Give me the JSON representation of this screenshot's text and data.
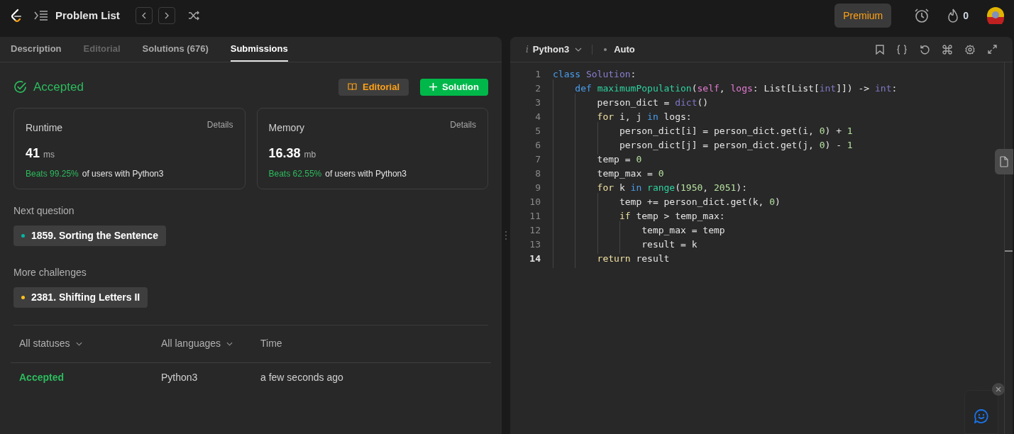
{
  "topbar": {
    "title": "Problem List",
    "premium": "Premium",
    "streak": "0"
  },
  "left_tabs": [
    {
      "label": "Description",
      "selected": false,
      "disabled": false
    },
    {
      "label": "Editorial",
      "selected": false,
      "disabled": true
    },
    {
      "label": "Solutions (676)",
      "selected": false,
      "disabled": false
    },
    {
      "label": "Submissions",
      "selected": true,
      "disabled": false
    }
  ],
  "result": {
    "status": "Accepted",
    "editorial_button": "Editorial",
    "solution_button": "Solution"
  },
  "stats": [
    {
      "title": "Runtime",
      "details": "Details",
      "value": "41",
      "unit": "ms",
      "beats": "Beats 99.25%",
      "suffix": "of users with Python3"
    },
    {
      "title": "Memory",
      "details": "Details",
      "value": "16.38",
      "unit": "mb",
      "beats": "Beats 62.55%",
      "suffix": "of users with Python3"
    }
  ],
  "next_question": {
    "heading": "Next question",
    "label": "1859. Sorting the Sentence",
    "color": "#00b8a3"
  },
  "more_challenges": {
    "heading": "More challenges",
    "label": "2381. Shifting Letters II",
    "color": "#ffc01e"
  },
  "submissions": {
    "columns": [
      "All statuses",
      "All languages",
      "Time"
    ],
    "rows": [
      {
        "status": "Accepted",
        "language": "Python3",
        "time": "a few seconds ago"
      }
    ]
  },
  "editor": {
    "info_glyph": "i",
    "language": "Python3",
    "mode": "Auto",
    "lines": [
      {
        "number": "1",
        "current": false,
        "tokens": [
          {
            "kind": "kw",
            "t": "class "
          },
          {
            "kind": "cls",
            "t": "Solution"
          },
          {
            "kind": "p",
            "t": ":"
          }
        ]
      },
      {
        "number": "2",
        "current": false,
        "tokens": [
          {
            "kind": "kw",
            "t": "    def "
          },
          {
            "kind": "fn",
            "t": "maximumPopulation"
          },
          {
            "kind": "p",
            "t": "("
          },
          {
            "kind": "self",
            "t": "self"
          },
          {
            "kind": "p",
            "t": ", "
          },
          {
            "kind": "self",
            "t": "logs"
          },
          {
            "kind": "p",
            "t": ": List[List["
          },
          {
            "kind": "bi",
            "t": "int"
          },
          {
            "kind": "p",
            "t": "]]) -> "
          },
          {
            "kind": "bi",
            "t": "int"
          },
          {
            "kind": "p",
            "t": ":"
          }
        ]
      },
      {
        "number": "3",
        "current": false,
        "tokens": [
          {
            "kind": "p",
            "t": "        person_dict = "
          },
          {
            "kind": "bi",
            "t": "dict"
          },
          {
            "kind": "p",
            "t": "()"
          }
        ]
      },
      {
        "number": "4",
        "current": false,
        "tokens": [
          {
            "kind": "ctl",
            "t": "        for"
          },
          {
            "kind": "p",
            "t": " i, j "
          },
          {
            "kind": "kw",
            "t": "in"
          },
          {
            "kind": "p",
            "t": " logs:"
          }
        ]
      },
      {
        "number": "5",
        "current": false,
        "tokens": [
          {
            "kind": "p",
            "t": "            person_dict[i] = person_dict.get(i, "
          },
          {
            "kind": "num",
            "t": "0"
          },
          {
            "kind": "p",
            "t": ") + "
          },
          {
            "kind": "num",
            "t": "1"
          }
        ]
      },
      {
        "number": "6",
        "current": false,
        "tokens": [
          {
            "kind": "p",
            "t": "            person_dict[j] = person_dict.get(j, "
          },
          {
            "kind": "num",
            "t": "0"
          },
          {
            "kind": "p",
            "t": ") - "
          },
          {
            "kind": "num",
            "t": "1"
          }
        ]
      },
      {
        "number": "7",
        "current": false,
        "tokens": [
          {
            "kind": "p",
            "t": "        temp = "
          },
          {
            "kind": "num",
            "t": "0"
          }
        ]
      },
      {
        "number": "8",
        "current": false,
        "tokens": [
          {
            "kind": "p",
            "t": "        temp_max = "
          },
          {
            "kind": "num",
            "t": "0"
          }
        ]
      },
      {
        "number": "9",
        "current": false,
        "tokens": [
          {
            "kind": "ctl",
            "t": "        for"
          },
          {
            "kind": "p",
            "t": " k "
          },
          {
            "kind": "kw",
            "t": "in "
          },
          {
            "kind": "fn",
            "t": "range"
          },
          {
            "kind": "p",
            "t": "("
          },
          {
            "kind": "num",
            "t": "1950"
          },
          {
            "kind": "p",
            "t": ", "
          },
          {
            "kind": "num",
            "t": "2051"
          },
          {
            "kind": "p",
            "t": "):"
          }
        ]
      },
      {
        "number": "10",
        "current": false,
        "tokens": [
          {
            "kind": "p",
            "t": "            temp += person_dict.get(k, "
          },
          {
            "kind": "num",
            "t": "0"
          },
          {
            "kind": "p",
            "t": ")"
          }
        ]
      },
      {
        "number": "11",
        "current": false,
        "tokens": [
          {
            "kind": "ctl",
            "t": "            if"
          },
          {
            "kind": "p",
            "t": " temp > temp_max:"
          }
        ]
      },
      {
        "number": "12",
        "current": false,
        "tokens": [
          {
            "kind": "p",
            "t": "                temp_max = temp"
          }
        ]
      },
      {
        "number": "13",
        "current": false,
        "tokens": [
          {
            "kind": "p",
            "t": "                result = k"
          }
        ]
      },
      {
        "number": "14",
        "current": true,
        "tokens": [
          {
            "kind": "ctl",
            "t": "        return"
          },
          {
            "kind": "p",
            "t": " result"
          }
        ]
      }
    ]
  }
}
